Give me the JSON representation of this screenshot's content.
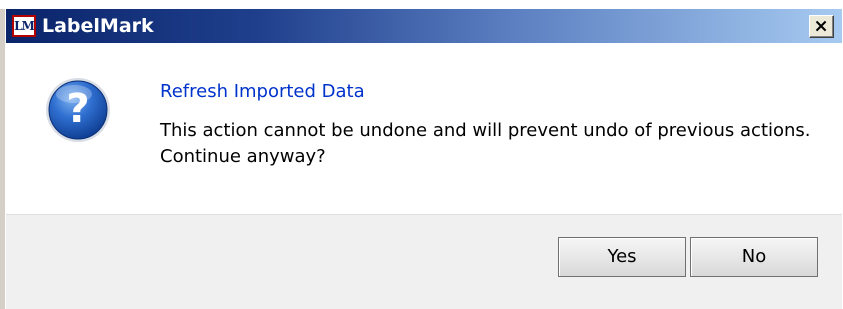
{
  "window": {
    "title": "LabelMark",
    "logo_text": "LM",
    "close_icon": "close-icon"
  },
  "message": {
    "icon": "question-icon",
    "heading": "Refresh Imported Data",
    "body": "This action cannot be undone and will prevent undo of previous actions.  Continue anyway?"
  },
  "buttons": {
    "yes_label": "Yes",
    "no_label": "No"
  },
  "colors": {
    "heading": "#0033cc",
    "titlebar_start": "#0a246a",
    "titlebar_end": "#a6caf0",
    "button_area": "#f0f0f0"
  }
}
